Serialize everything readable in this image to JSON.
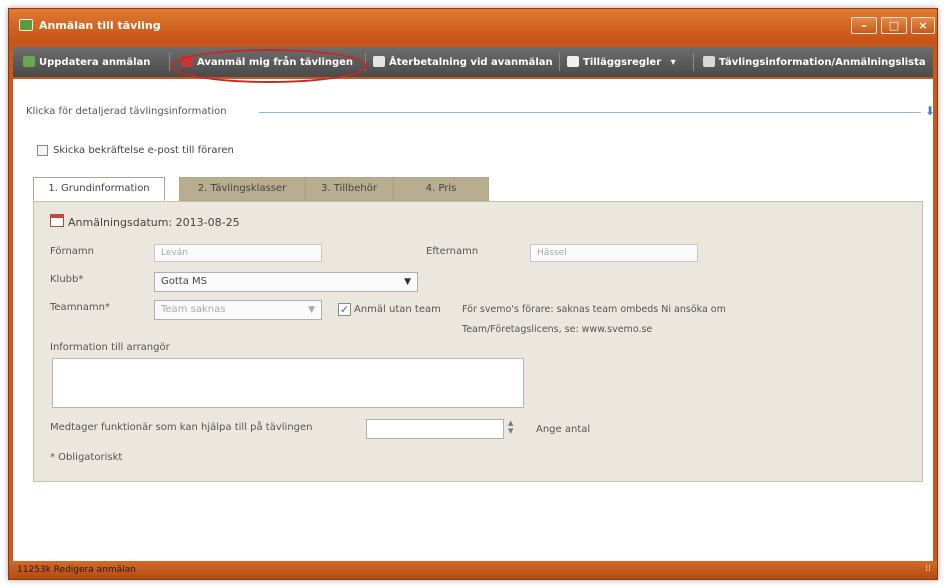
{
  "window": {
    "title": "Anmälan till tävling",
    "controls": [
      "–",
      "□",
      "×"
    ]
  },
  "toolbar": {
    "items": [
      {
        "label": "Uppdatera anmälan",
        "icon": "refresh-icon"
      },
      {
        "label": "Avanmäl mig från tävlingen",
        "icon": "remove-icon"
      },
      {
        "label": "Återbetalning vid avanmälan",
        "icon": "money-icon"
      },
      {
        "label": "Tilläggsregler",
        "icon": "document-icon",
        "dropdown": "▾"
      },
      {
        "label": "Tävlingsinformation/Anmälningslista",
        "icon": "info-list-icon"
      }
    ]
  },
  "details": {
    "link_label": "Klicka för detaljerad tävlingsinformation",
    "expand_arrow": "⬇"
  },
  "confirm_email": {
    "label": "Skicka bekräftelse e-post till föraren",
    "checked": false
  },
  "tabs": [
    {
      "label": "1. Grundinformation",
      "active": true
    },
    {
      "label": "2. Tävlingsklasser",
      "active": false
    },
    {
      "label": "3. Tillbehör",
      "active": false
    },
    {
      "label": "4. Pris",
      "active": false
    }
  ],
  "form": {
    "registration_date_label": "Anmälningsdatum: 2013-08-25",
    "firstname_label": "Förnamn",
    "firstname_value": "Leván",
    "lastname_label": "Efternamn",
    "lastname_value": "Hässel",
    "club_label": "Klubb*",
    "club_value": "Gotta MS",
    "team_label": "Teamnamn*",
    "team_placeholder": "Team saknas",
    "no_team_label": "Anmäl utan team",
    "no_team_checked": true,
    "team_info": "För svemo's förare: saknas team ombeds Ni ansöka om Team/Företagslicens, se: www.svemo.se",
    "organizer_info_label": "Information till arrangör",
    "official_label": "Medtager funktionär som kan hjälpa till på tävlingen",
    "official_value": "",
    "official_hint": "Ange antal",
    "required_note": "* Obligatoriskt"
  },
  "statusbar": {
    "text": "11253k Redigera anmälan",
    "grip": "⁞⁞"
  },
  "colors": {
    "frame": "#c8581c",
    "toolbar": "#555555",
    "panel": "#ebe7df",
    "tab_inactive": "#b9ad8f",
    "highlight": "#c8281e"
  }
}
